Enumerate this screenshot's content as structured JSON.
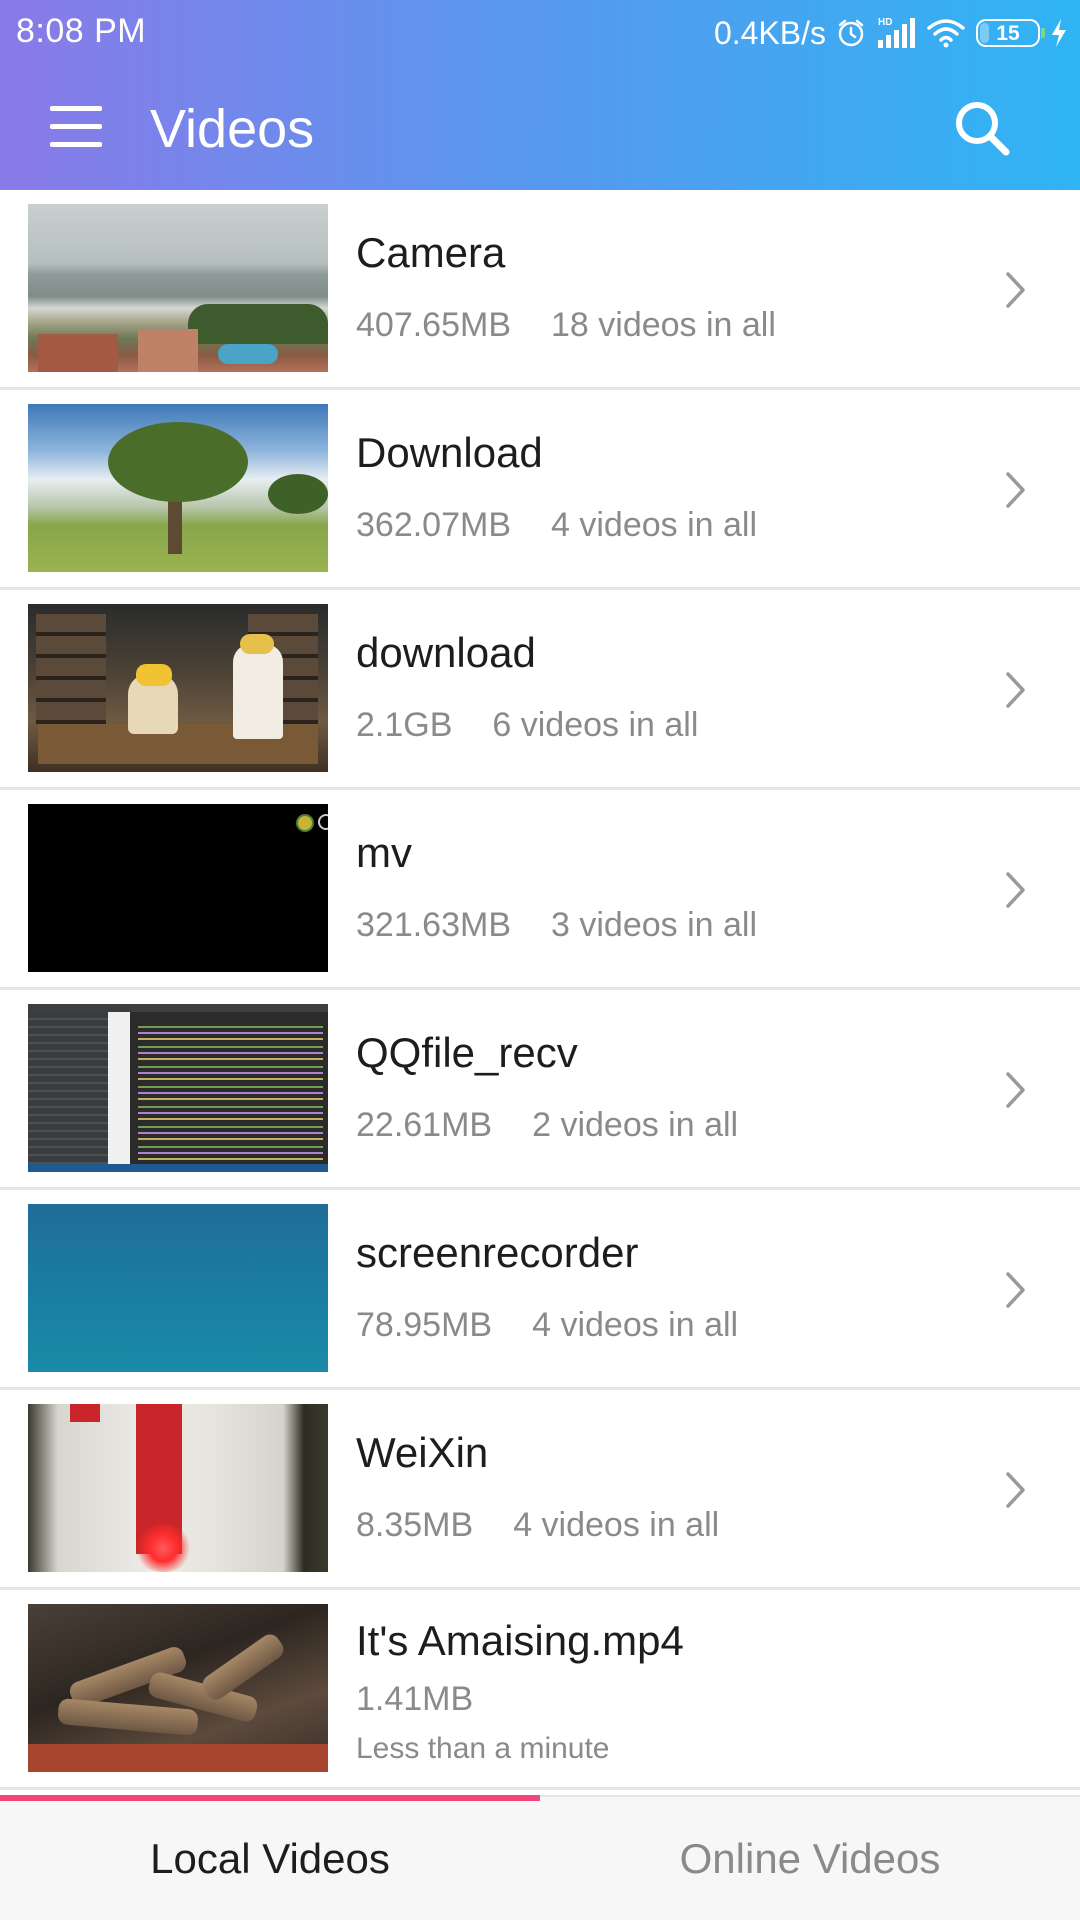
{
  "status_bar": {
    "time": "8:08 PM",
    "network_speed": "0.4KB/s",
    "network_type": "HD",
    "battery_level": "15",
    "icons": [
      "alarm-icon",
      "signal-icon",
      "wifi-icon",
      "battery-icon",
      "charging-icon"
    ]
  },
  "header": {
    "title": "Videos",
    "menu_icon": "hamburger-menu-icon",
    "search_icon": "search-icon"
  },
  "folders": [
    {
      "name": "Camera",
      "size": "407.65MB",
      "count": "18 videos in all"
    },
    {
      "name": "Download",
      "size": "362.07MB",
      "count": "4 videos in all"
    },
    {
      "name": "download",
      "size": "2.1GB",
      "count": "6 videos in all"
    },
    {
      "name": "mv",
      "size": "321.63MB",
      "count": "3 videos in all"
    },
    {
      "name": "QQfile_recv",
      "size": "22.61MB",
      "count": "2 videos in all"
    },
    {
      "name": "screenrecorder",
      "size": "78.95MB",
      "count": "4 videos in all"
    },
    {
      "name": "WeiXin",
      "size": "8.35MB",
      "count": "4 videos in all"
    }
  ],
  "files": [
    {
      "name": "It's Amaising.mp4",
      "size": "1.41MB",
      "duration": "Less than a minute"
    }
  ],
  "tabs": [
    {
      "label": "Local Videos",
      "active": true
    },
    {
      "label": "Online Videos",
      "active": false
    }
  ],
  "colors": {
    "header_gradient_start": "#8a7ae8",
    "header_gradient_end": "#2fb4f4",
    "tab_indicator": "#f2457a",
    "primary_text": "#1d1d1d",
    "secondary_text": "#8a8a8a"
  }
}
